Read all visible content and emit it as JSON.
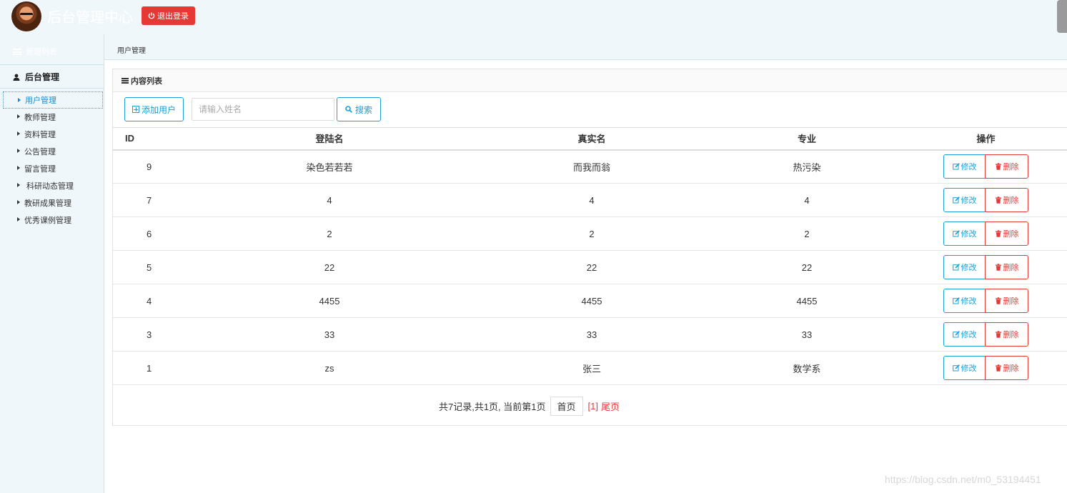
{
  "header": {
    "app_title": "后台管理中心",
    "logout_label": "退出登录",
    "accent_color": "#e53935"
  },
  "sidebar": {
    "title": "管理列表",
    "group_label": "后台管理",
    "items": [
      {
        "label": "用户管理",
        "active": true
      },
      {
        "label": "教师管理"
      },
      {
        "label": "资料管理"
      },
      {
        "label": "公告管理"
      },
      {
        "label": "留言管理"
      },
      {
        "label": " 科研动态管理"
      },
      {
        "label": "教研成果管理"
      },
      {
        "label": "优秀课例管理"
      }
    ]
  },
  "breadcrumb": "用户管理",
  "panel": {
    "title": "内容列表",
    "add_button": "添加用户",
    "search_placeholder": "请输入姓名",
    "search_button": "搜索"
  },
  "table": {
    "headers": [
      "ID",
      "登陆名",
      "真实名",
      "专业",
      "操作"
    ],
    "edit_label": "修改",
    "delete_label": "删除",
    "rows": [
      {
        "id": "9",
        "login": "染色若若若",
        "real": "而我而翁",
        "major": "热污染"
      },
      {
        "id": "7",
        "login": "4",
        "real": "4",
        "major": "4"
      },
      {
        "id": "6",
        "login": "2",
        "real": "2",
        "major": "2"
      },
      {
        "id": "5",
        "login": "22",
        "real": "22",
        "major": "22"
      },
      {
        "id": "4",
        "login": "4455",
        "real": "4455",
        "major": "4455"
      },
      {
        "id": "3",
        "login": "33",
        "real": "33",
        "major": "33"
      },
      {
        "id": "1",
        "login": "zs",
        "real": "张三",
        "major": "数学系"
      }
    ]
  },
  "pager": {
    "info": "共7记录,共1页, 当前第1页",
    "first": "首页",
    "current": "[1]",
    "last": "尾页"
  },
  "watermark": "https://blog.csdn.net/m0_53194451"
}
